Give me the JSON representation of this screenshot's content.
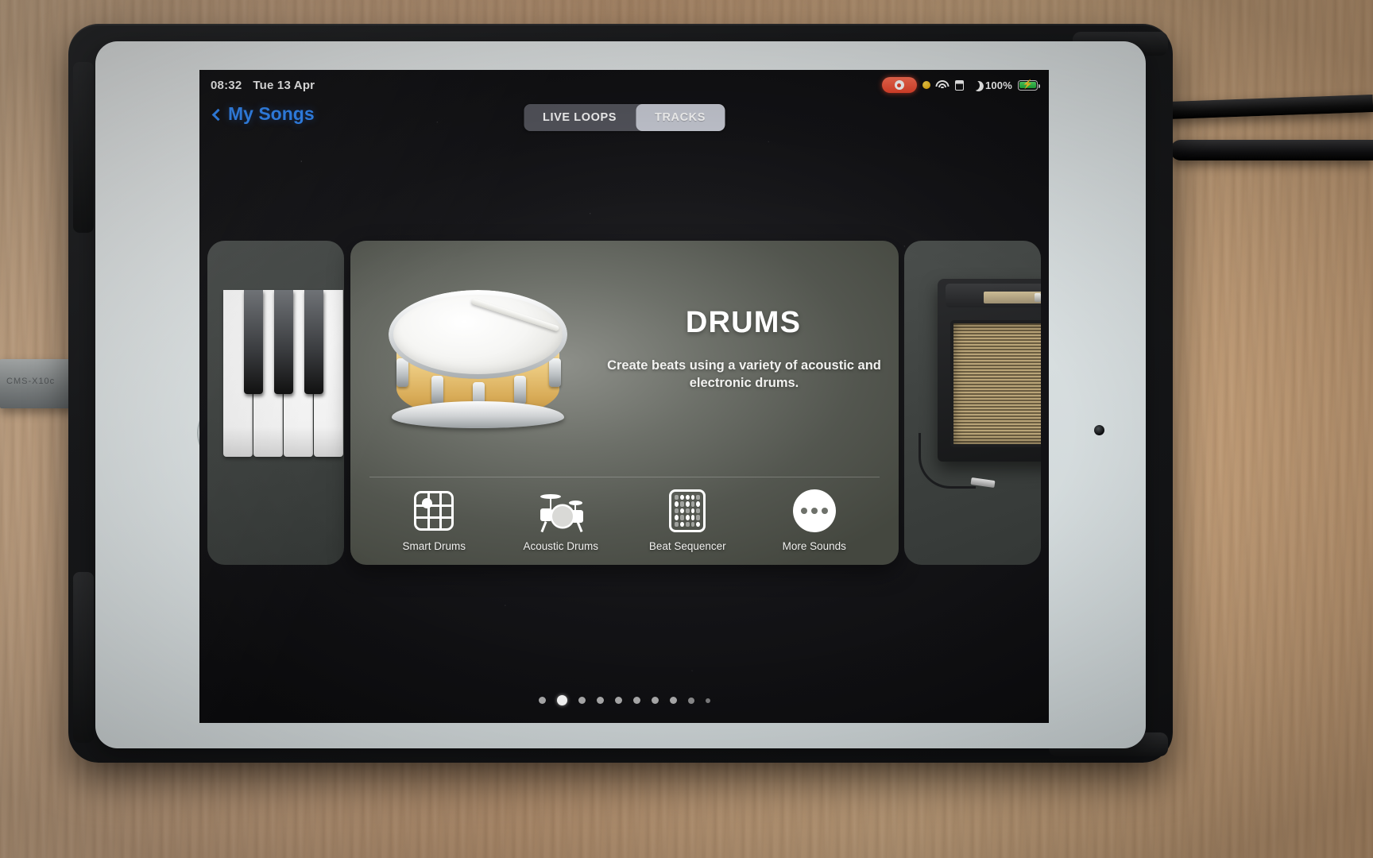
{
  "status_bar": {
    "time": "08:32",
    "date": "Tue 13 Apr",
    "battery_percent": "100%",
    "icons": [
      "screen-recording-pill",
      "orange-privacy-dot",
      "wifi-icon",
      "sim-icon",
      "do-not-disturb-moon-icon",
      "battery-charging-icon"
    ]
  },
  "nav": {
    "back_label": "My Songs",
    "tabs": [
      {
        "label": "LIVE LOOPS",
        "active": false
      },
      {
        "label": "TRACKS",
        "active": true
      }
    ]
  },
  "carousel": {
    "left_card": {
      "instrument": "keyboard",
      "icon": "piano-keys"
    },
    "right_card": {
      "instrument": "amp",
      "icon": "guitar-amplifier"
    },
    "main_card": {
      "title": "DRUMS",
      "description": "Create beats using a variety of acoustic and electronic drums.",
      "image": "snare-drum",
      "options": [
        {
          "label": "Smart Drums",
          "icon": "smart-drums-grid-icon"
        },
        {
          "label": "Acoustic Drums",
          "icon": "drum-kit-icon"
        },
        {
          "label": "Beat Sequencer",
          "icon": "beat-sequencer-pads-icon"
        },
        {
          "label": "More Sounds",
          "icon": "ellipsis-circle-icon"
        }
      ]
    },
    "page_dots": {
      "count": 10,
      "active_index": 1
    }
  },
  "device": {
    "strip_text": "CMS-X10c"
  },
  "colors": {
    "accent_blue": "#2f8bff",
    "record_red": "#e8442c",
    "battery_green": "#2fc24a",
    "card_grey": "#6d7069"
  }
}
